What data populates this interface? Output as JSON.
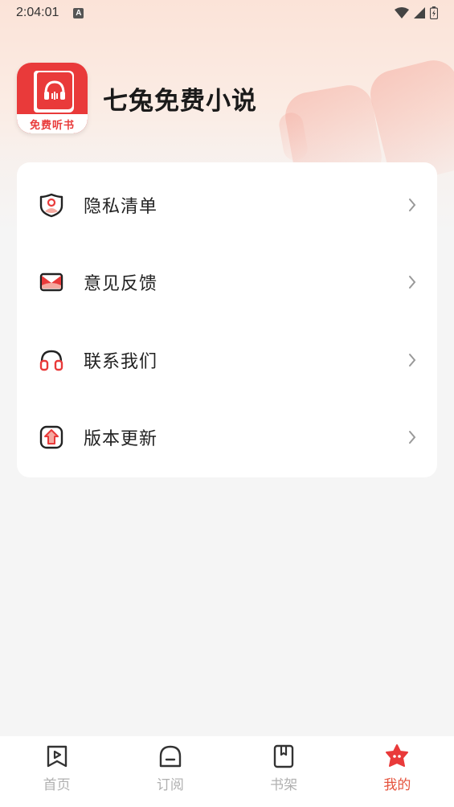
{
  "status_bar": {
    "time": "2:04:01",
    "indicator": "A"
  },
  "app": {
    "name": "七兔免费小说",
    "logo_text": "免费听书"
  },
  "menu": [
    {
      "label": "隐私清单",
      "icon": "privacy-shield-icon"
    },
    {
      "label": "意见反馈",
      "icon": "mail-icon"
    },
    {
      "label": "联系我们",
      "icon": "headset-icon"
    },
    {
      "label": "版本更新",
      "icon": "update-arrow-icon"
    }
  ],
  "nav": [
    {
      "label": "首页",
      "icon": "bookmark-play-icon",
      "active": false
    },
    {
      "label": "订阅",
      "icon": "subscription-icon",
      "active": false
    },
    {
      "label": "书架",
      "icon": "book-icon",
      "active": false
    },
    {
      "label": "我的",
      "icon": "star-face-icon",
      "active": true
    }
  ],
  "colors": {
    "accent": "#e5533d",
    "brand": "#e93a3a",
    "inactive": "#b0b0b0"
  }
}
